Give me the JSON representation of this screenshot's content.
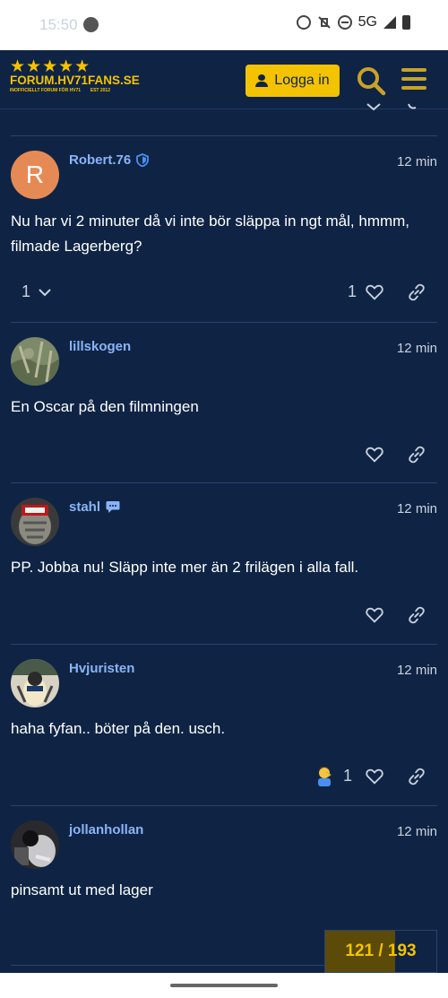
{
  "status_bar": {
    "time": "15:50",
    "network": "5G"
  },
  "header": {
    "logo": {
      "stars": "★★★★★",
      "name": "FORUM.HV71FANS.SE",
      "sub_left": "INOFFICIELLT FORUM FÖR HV71",
      "sub_right": "EST 2012"
    },
    "login_label": "Logga in",
    "accent": "#f3c300"
  },
  "posts": [
    {
      "username": "Robert.76",
      "avatar_letter": "R",
      "time": "12 min",
      "content": "Nu har vi 2 minuter då vi inte bör släppa in ngt mål, hmmm, filmade Lagerberg?",
      "replies": "1",
      "likes": "1"
    },
    {
      "username": "lillskogen",
      "time": "12 min",
      "content": "En Oscar på den filmningen"
    },
    {
      "username": "stahl",
      "time": "12 min",
      "content": "PP. Jobba nu! Släpp inte mer än 2 frilägen i alla fall."
    },
    {
      "username": "Hvjuristen",
      "time": "12 min",
      "content": "haha fyfan.. böter på den. usch.",
      "likes": "1"
    },
    {
      "username": "jollanhollan",
      "time": "12 min",
      "content": "pinsamt ut med lager"
    }
  ],
  "progress": {
    "label": "121 / 193",
    "fraction": 0.627
  }
}
